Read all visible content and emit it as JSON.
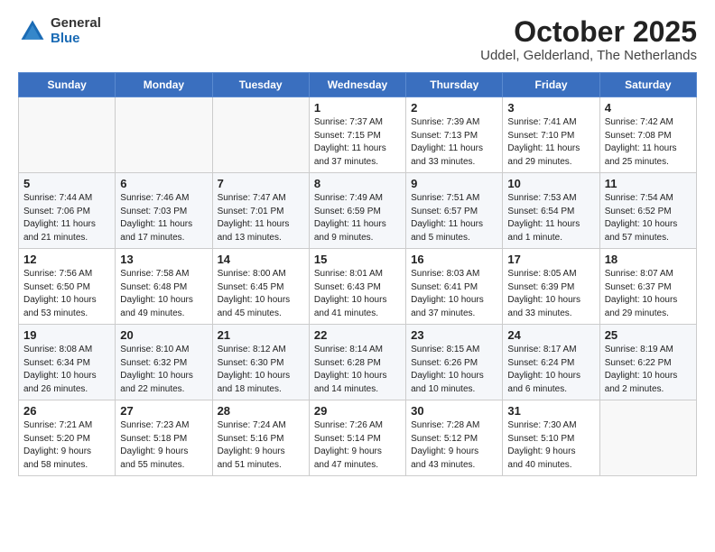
{
  "header": {
    "logo_general": "General",
    "logo_blue": "Blue",
    "title": "October 2025",
    "subtitle": "Uddel, Gelderland, The Netherlands"
  },
  "days_of_week": [
    "Sunday",
    "Monday",
    "Tuesday",
    "Wednesday",
    "Thursday",
    "Friday",
    "Saturday"
  ],
  "weeks": [
    [
      {
        "num": "",
        "info": ""
      },
      {
        "num": "",
        "info": ""
      },
      {
        "num": "",
        "info": ""
      },
      {
        "num": "1",
        "info": "Sunrise: 7:37 AM\nSunset: 7:15 PM\nDaylight: 11 hours\nand 37 minutes."
      },
      {
        "num": "2",
        "info": "Sunrise: 7:39 AM\nSunset: 7:13 PM\nDaylight: 11 hours\nand 33 minutes."
      },
      {
        "num": "3",
        "info": "Sunrise: 7:41 AM\nSunset: 7:10 PM\nDaylight: 11 hours\nand 29 minutes."
      },
      {
        "num": "4",
        "info": "Sunrise: 7:42 AM\nSunset: 7:08 PM\nDaylight: 11 hours\nand 25 minutes."
      }
    ],
    [
      {
        "num": "5",
        "info": "Sunrise: 7:44 AM\nSunset: 7:06 PM\nDaylight: 11 hours\nand 21 minutes."
      },
      {
        "num": "6",
        "info": "Sunrise: 7:46 AM\nSunset: 7:03 PM\nDaylight: 11 hours\nand 17 minutes."
      },
      {
        "num": "7",
        "info": "Sunrise: 7:47 AM\nSunset: 7:01 PM\nDaylight: 11 hours\nand 13 minutes."
      },
      {
        "num": "8",
        "info": "Sunrise: 7:49 AM\nSunset: 6:59 PM\nDaylight: 11 hours\nand 9 minutes."
      },
      {
        "num": "9",
        "info": "Sunrise: 7:51 AM\nSunset: 6:57 PM\nDaylight: 11 hours\nand 5 minutes."
      },
      {
        "num": "10",
        "info": "Sunrise: 7:53 AM\nSunset: 6:54 PM\nDaylight: 11 hours\nand 1 minute."
      },
      {
        "num": "11",
        "info": "Sunrise: 7:54 AM\nSunset: 6:52 PM\nDaylight: 10 hours\nand 57 minutes."
      }
    ],
    [
      {
        "num": "12",
        "info": "Sunrise: 7:56 AM\nSunset: 6:50 PM\nDaylight: 10 hours\nand 53 minutes."
      },
      {
        "num": "13",
        "info": "Sunrise: 7:58 AM\nSunset: 6:48 PM\nDaylight: 10 hours\nand 49 minutes."
      },
      {
        "num": "14",
        "info": "Sunrise: 8:00 AM\nSunset: 6:45 PM\nDaylight: 10 hours\nand 45 minutes."
      },
      {
        "num": "15",
        "info": "Sunrise: 8:01 AM\nSunset: 6:43 PM\nDaylight: 10 hours\nand 41 minutes."
      },
      {
        "num": "16",
        "info": "Sunrise: 8:03 AM\nSunset: 6:41 PM\nDaylight: 10 hours\nand 37 minutes."
      },
      {
        "num": "17",
        "info": "Sunrise: 8:05 AM\nSunset: 6:39 PM\nDaylight: 10 hours\nand 33 minutes."
      },
      {
        "num": "18",
        "info": "Sunrise: 8:07 AM\nSunset: 6:37 PM\nDaylight: 10 hours\nand 29 minutes."
      }
    ],
    [
      {
        "num": "19",
        "info": "Sunrise: 8:08 AM\nSunset: 6:34 PM\nDaylight: 10 hours\nand 26 minutes."
      },
      {
        "num": "20",
        "info": "Sunrise: 8:10 AM\nSunset: 6:32 PM\nDaylight: 10 hours\nand 22 minutes."
      },
      {
        "num": "21",
        "info": "Sunrise: 8:12 AM\nSunset: 6:30 PM\nDaylight: 10 hours\nand 18 minutes."
      },
      {
        "num": "22",
        "info": "Sunrise: 8:14 AM\nSunset: 6:28 PM\nDaylight: 10 hours\nand 14 minutes."
      },
      {
        "num": "23",
        "info": "Sunrise: 8:15 AM\nSunset: 6:26 PM\nDaylight: 10 hours\nand 10 minutes."
      },
      {
        "num": "24",
        "info": "Sunrise: 8:17 AM\nSunset: 6:24 PM\nDaylight: 10 hours\nand 6 minutes."
      },
      {
        "num": "25",
        "info": "Sunrise: 8:19 AM\nSunset: 6:22 PM\nDaylight: 10 hours\nand 2 minutes."
      }
    ],
    [
      {
        "num": "26",
        "info": "Sunrise: 7:21 AM\nSunset: 5:20 PM\nDaylight: 9 hours\nand 58 minutes."
      },
      {
        "num": "27",
        "info": "Sunrise: 7:23 AM\nSunset: 5:18 PM\nDaylight: 9 hours\nand 55 minutes."
      },
      {
        "num": "28",
        "info": "Sunrise: 7:24 AM\nSunset: 5:16 PM\nDaylight: 9 hours\nand 51 minutes."
      },
      {
        "num": "29",
        "info": "Sunrise: 7:26 AM\nSunset: 5:14 PM\nDaylight: 9 hours\nand 47 minutes."
      },
      {
        "num": "30",
        "info": "Sunrise: 7:28 AM\nSunset: 5:12 PM\nDaylight: 9 hours\nand 43 minutes."
      },
      {
        "num": "31",
        "info": "Sunrise: 7:30 AM\nSunset: 5:10 PM\nDaylight: 9 hours\nand 40 minutes."
      },
      {
        "num": "",
        "info": ""
      }
    ]
  ]
}
